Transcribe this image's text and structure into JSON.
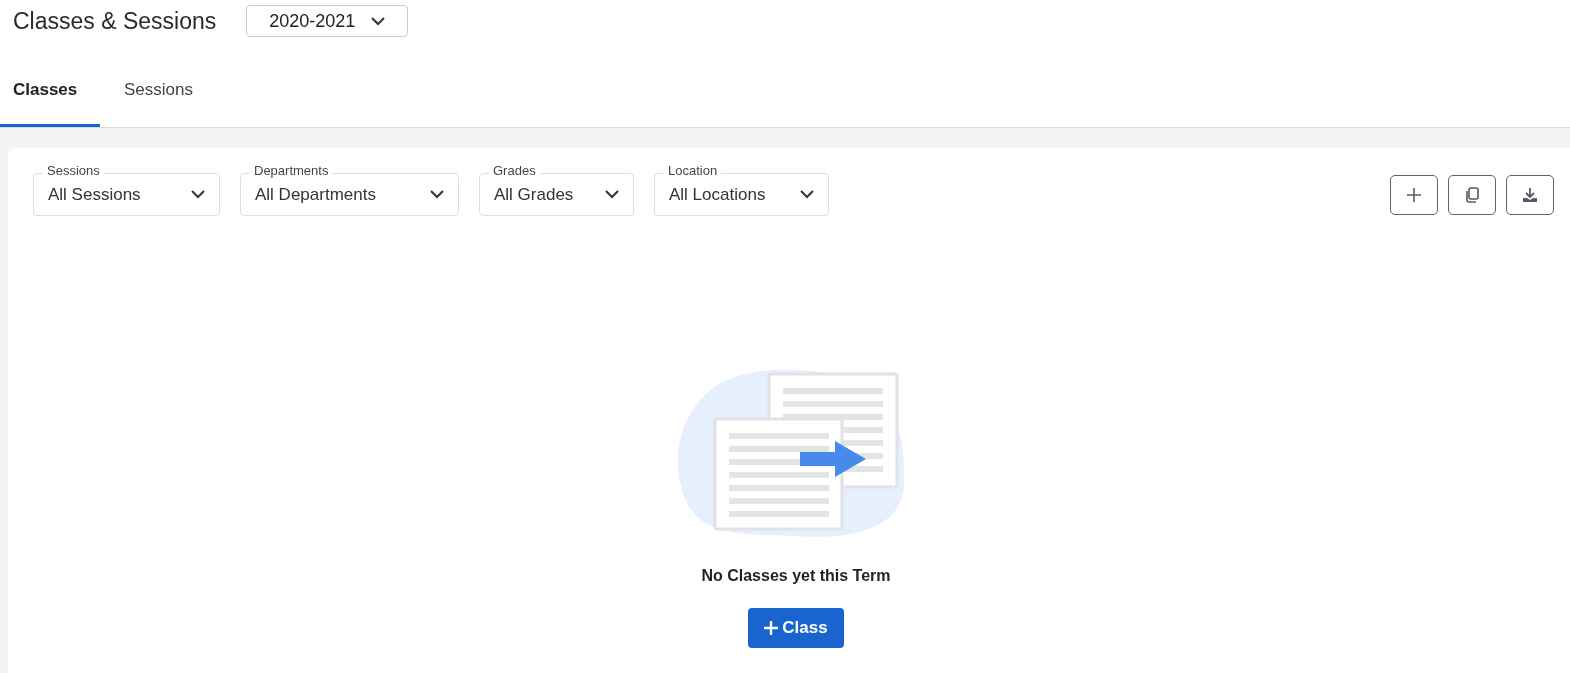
{
  "header": {
    "title": "Classes & Sessions",
    "year_select": {
      "value": "2020-2021"
    }
  },
  "tabs": [
    {
      "label": "Classes",
      "selected": true
    },
    {
      "label": "Sessions",
      "selected": false
    }
  ],
  "filters": [
    {
      "label": "Sessions",
      "value": "All Sessions"
    },
    {
      "label": "Departments",
      "value": "All Departments"
    },
    {
      "label": "Grades",
      "value": "All Grades"
    },
    {
      "label": "Location",
      "value": "All Locations"
    }
  ],
  "toolbar": [
    {
      "kind": "add"
    },
    {
      "kind": "copy"
    },
    {
      "kind": "download"
    }
  ],
  "empty_state": {
    "message": "No Classes yet this Term",
    "button": "Class"
  }
}
